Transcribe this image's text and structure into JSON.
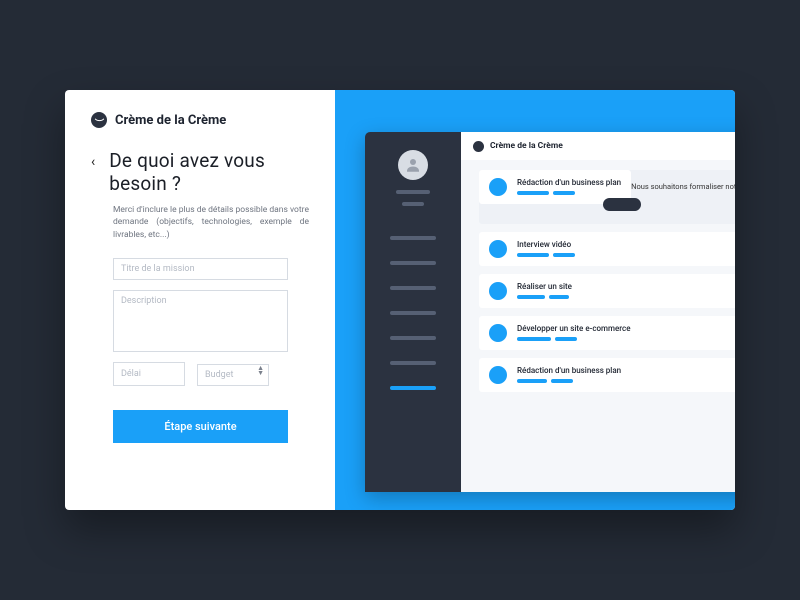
{
  "brand": {
    "name": "Crème de la Crème"
  },
  "form": {
    "title": "De quoi avez vous besoin ?",
    "description": "Merci d'inclure le plus de détails possible dans votre demande (objectifs, technologies, exemple de livrables, etc...)",
    "fields": {
      "title_placeholder": "Titre de la mission",
      "description_placeholder": "Description",
      "delay_placeholder": "Délai",
      "budget_placeholder": "Budget"
    },
    "submit_label": "Étape suivante"
  },
  "preview": {
    "brand": "Crème de la Crème",
    "items": [
      {
        "title": "Rédaction d'un business plan",
        "detail": "Nous souhaitons formaliser notre projet d'agence"
      },
      {
        "title": "Interview vidéo"
      },
      {
        "title": "Réaliser un site"
      },
      {
        "title": "Développer un site e-commerce"
      },
      {
        "title": "Rédaction d'un business plan"
      }
    ]
  },
  "colors": {
    "accent": "#1aa0f8",
    "bg": "#242b36",
    "dark": "#2b3240"
  }
}
